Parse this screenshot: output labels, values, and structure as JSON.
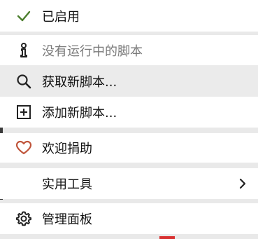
{
  "menu": {
    "items": [
      {
        "label": "已启用",
        "icon": "check-icon",
        "muted": false
      },
      {
        "label": "没有运行中的脚本",
        "icon": "info-icon",
        "muted": true
      },
      {
        "label": "获取新脚本...",
        "icon": "search-icon",
        "muted": false
      },
      {
        "label": "添加新脚本...",
        "icon": "plus-square-icon",
        "muted": false
      },
      {
        "label": "欢迎捐助",
        "icon": "heart-icon",
        "muted": false
      },
      {
        "label": "实用工具",
        "icon": "",
        "muted": false,
        "submenu_icon": "chevron-right-icon"
      },
      {
        "label": "管理面板",
        "icon": "gear-icon",
        "muted": false
      }
    ]
  },
  "colors": {
    "check": "#4a7d2b",
    "heart": "#c0553b",
    "icon": "#222222",
    "muted_icon": "#6a6a6a"
  }
}
